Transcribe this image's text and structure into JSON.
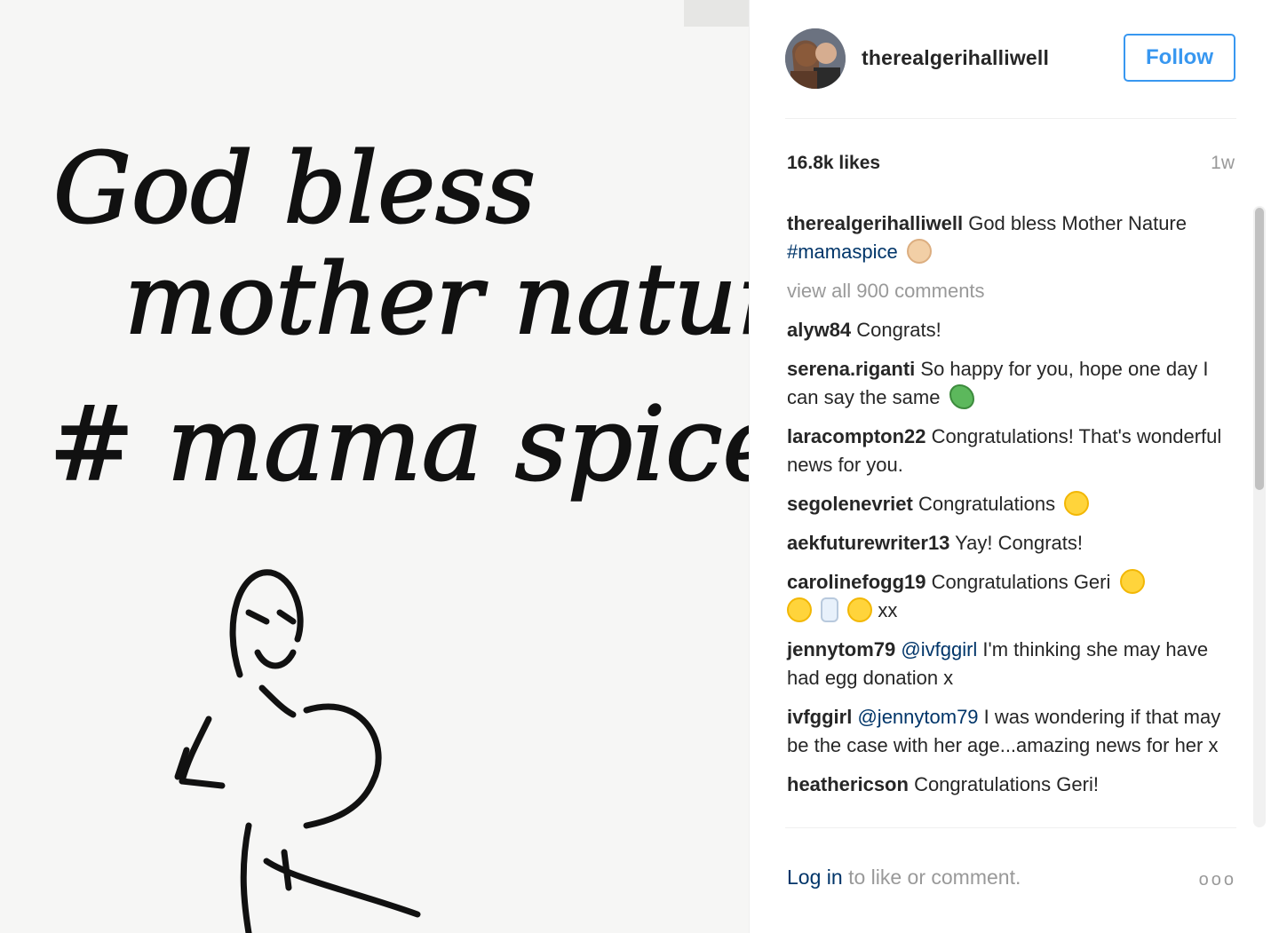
{
  "post": {
    "username": "therealgerihalliwell",
    "follow_label": "Follow",
    "likes": "16.8k likes",
    "age": "1w",
    "caption": {
      "user": "therealgerihalliwell",
      "text": "God bless Mother Nature",
      "hashtag": "#mamaspice",
      "emoji": "baby-emoji"
    },
    "view_all": "view all 900 comments",
    "comments": [
      {
        "user": "alyw84",
        "text": "Congrats!"
      },
      {
        "user": "serena.riganti",
        "text": "So happy for you, hope one day I can say the same",
        "emoji": "four-leaf-clover-emoji"
      },
      {
        "user": "laracompton22",
        "text": "Congratulations! That's wonderful news for you."
      },
      {
        "user": "segolenevriet",
        "text": "Congratulations",
        "emoji": "smiling-face-emoji"
      },
      {
        "user": "aekfuturewriter13",
        "text": "Yay! Congrats!"
      },
      {
        "user": "carolinefogg19",
        "text": "Congratulations Geri",
        "emoji": "smiling-face-emoji",
        "extra_emojis": [
          "heart-eyes-emoji",
          "baby-bottle-emoji",
          "baby-chick-emoji"
        ],
        "suffix": "xx"
      },
      {
        "user": "jennytom79",
        "mention": "@ivfggirl",
        "text": "I'm thinking she may have had egg donation x"
      },
      {
        "user": "ivfggirl",
        "mention": "@jennytom79",
        "text": "I was wondering if that may be the case with her age...amazing news for her x"
      },
      {
        "user": "heathericson",
        "text": "Congratulations Geri!"
      }
    ],
    "footer": {
      "login": "Log in",
      "rest": "to like or comment.",
      "more": "ooo"
    }
  },
  "image_text": {
    "line1": "God bless",
    "line2": "mother nature",
    "line3": "# mama spice"
  },
  "colors": {
    "accent": "#3897f0",
    "link": "#003569",
    "muted": "#999999",
    "text": "#262626"
  }
}
